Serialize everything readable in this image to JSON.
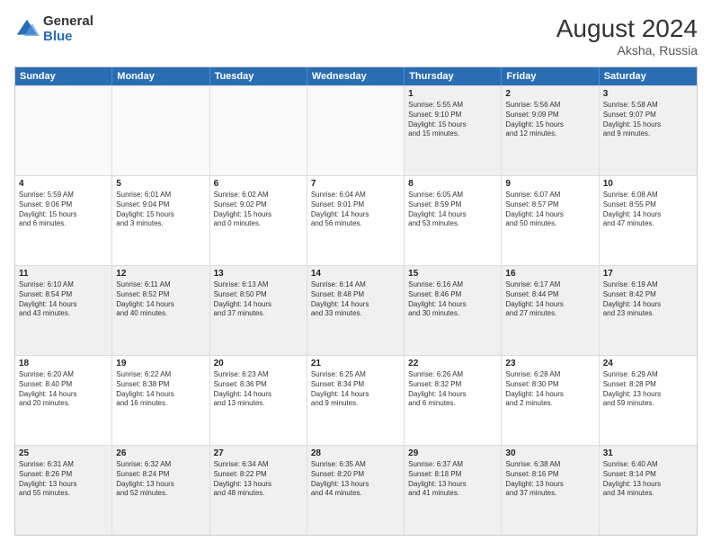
{
  "logo": {
    "general": "General",
    "blue": "Blue"
  },
  "title": "August 2024",
  "location": "Aksha, Russia",
  "header_days": [
    "Sunday",
    "Monday",
    "Tuesday",
    "Wednesday",
    "Thursday",
    "Friday",
    "Saturday"
  ],
  "rows": [
    [
      {
        "day": "",
        "text": "",
        "empty": true
      },
      {
        "day": "",
        "text": "",
        "empty": true
      },
      {
        "day": "",
        "text": "",
        "empty": true
      },
      {
        "day": "",
        "text": "",
        "empty": true
      },
      {
        "day": "1",
        "text": "Sunrise: 5:55 AM\nSunset: 9:10 PM\nDaylight: 15 hours\nand 15 minutes.",
        "empty": false
      },
      {
        "day": "2",
        "text": "Sunrise: 5:56 AM\nSunset: 9:09 PM\nDaylight: 15 hours\nand 12 minutes.",
        "empty": false
      },
      {
        "day": "3",
        "text": "Sunrise: 5:58 AM\nSunset: 9:07 PM\nDaylight: 15 hours\nand 9 minutes.",
        "empty": false
      }
    ],
    [
      {
        "day": "4",
        "text": "Sunrise: 5:59 AM\nSunset: 9:06 PM\nDaylight: 15 hours\nand 6 minutes.",
        "empty": false
      },
      {
        "day": "5",
        "text": "Sunrise: 6:01 AM\nSunset: 9:04 PM\nDaylight: 15 hours\nand 3 minutes.",
        "empty": false
      },
      {
        "day": "6",
        "text": "Sunrise: 6:02 AM\nSunset: 9:02 PM\nDaylight: 15 hours\nand 0 minutes.",
        "empty": false
      },
      {
        "day": "7",
        "text": "Sunrise: 6:04 AM\nSunset: 9:01 PM\nDaylight: 14 hours\nand 56 minutes.",
        "empty": false
      },
      {
        "day": "8",
        "text": "Sunrise: 6:05 AM\nSunset: 8:59 PM\nDaylight: 14 hours\nand 53 minutes.",
        "empty": false
      },
      {
        "day": "9",
        "text": "Sunrise: 6:07 AM\nSunset: 8:57 PM\nDaylight: 14 hours\nand 50 minutes.",
        "empty": false
      },
      {
        "day": "10",
        "text": "Sunrise: 6:08 AM\nSunset: 8:55 PM\nDaylight: 14 hours\nand 47 minutes.",
        "empty": false
      }
    ],
    [
      {
        "day": "11",
        "text": "Sunrise: 6:10 AM\nSunset: 8:54 PM\nDaylight: 14 hours\nand 43 minutes.",
        "empty": false
      },
      {
        "day": "12",
        "text": "Sunrise: 6:11 AM\nSunset: 8:52 PM\nDaylight: 14 hours\nand 40 minutes.",
        "empty": false
      },
      {
        "day": "13",
        "text": "Sunrise: 6:13 AM\nSunset: 8:50 PM\nDaylight: 14 hours\nand 37 minutes.",
        "empty": false
      },
      {
        "day": "14",
        "text": "Sunrise: 6:14 AM\nSunset: 8:48 PM\nDaylight: 14 hours\nand 33 minutes.",
        "empty": false
      },
      {
        "day": "15",
        "text": "Sunrise: 6:16 AM\nSunset: 8:46 PM\nDaylight: 14 hours\nand 30 minutes.",
        "empty": false
      },
      {
        "day": "16",
        "text": "Sunrise: 6:17 AM\nSunset: 8:44 PM\nDaylight: 14 hours\nand 27 minutes.",
        "empty": false
      },
      {
        "day": "17",
        "text": "Sunrise: 6:19 AM\nSunset: 8:42 PM\nDaylight: 14 hours\nand 23 minutes.",
        "empty": false
      }
    ],
    [
      {
        "day": "18",
        "text": "Sunrise: 6:20 AM\nSunset: 8:40 PM\nDaylight: 14 hours\nand 20 minutes.",
        "empty": false
      },
      {
        "day": "19",
        "text": "Sunrise: 6:22 AM\nSunset: 8:38 PM\nDaylight: 14 hours\nand 16 minutes.",
        "empty": false
      },
      {
        "day": "20",
        "text": "Sunrise: 6:23 AM\nSunset: 8:36 PM\nDaylight: 14 hours\nand 13 minutes.",
        "empty": false
      },
      {
        "day": "21",
        "text": "Sunrise: 6:25 AM\nSunset: 8:34 PM\nDaylight: 14 hours\nand 9 minutes.",
        "empty": false
      },
      {
        "day": "22",
        "text": "Sunrise: 6:26 AM\nSunset: 8:32 PM\nDaylight: 14 hours\nand 6 minutes.",
        "empty": false
      },
      {
        "day": "23",
        "text": "Sunrise: 6:28 AM\nSunset: 8:30 PM\nDaylight: 14 hours\nand 2 minutes.",
        "empty": false
      },
      {
        "day": "24",
        "text": "Sunrise: 6:29 AM\nSunset: 8:28 PM\nDaylight: 13 hours\nand 59 minutes.",
        "empty": false
      }
    ],
    [
      {
        "day": "25",
        "text": "Sunrise: 6:31 AM\nSunset: 8:26 PM\nDaylight: 13 hours\nand 55 minutes.",
        "empty": false
      },
      {
        "day": "26",
        "text": "Sunrise: 6:32 AM\nSunset: 8:24 PM\nDaylight: 13 hours\nand 52 minutes.",
        "empty": false
      },
      {
        "day": "27",
        "text": "Sunrise: 6:34 AM\nSunset: 8:22 PM\nDaylight: 13 hours\nand 48 minutes.",
        "empty": false
      },
      {
        "day": "28",
        "text": "Sunrise: 6:35 AM\nSunset: 8:20 PM\nDaylight: 13 hours\nand 44 minutes.",
        "empty": false
      },
      {
        "day": "29",
        "text": "Sunrise: 6:37 AM\nSunset: 8:18 PM\nDaylight: 13 hours\nand 41 minutes.",
        "empty": false
      },
      {
        "day": "30",
        "text": "Sunrise: 6:38 AM\nSunset: 8:16 PM\nDaylight: 13 hours\nand 37 minutes.",
        "empty": false
      },
      {
        "day": "31",
        "text": "Sunrise: 6:40 AM\nSunset: 8:14 PM\nDaylight: 13 hours\nand 34 minutes.",
        "empty": false
      }
    ]
  ]
}
